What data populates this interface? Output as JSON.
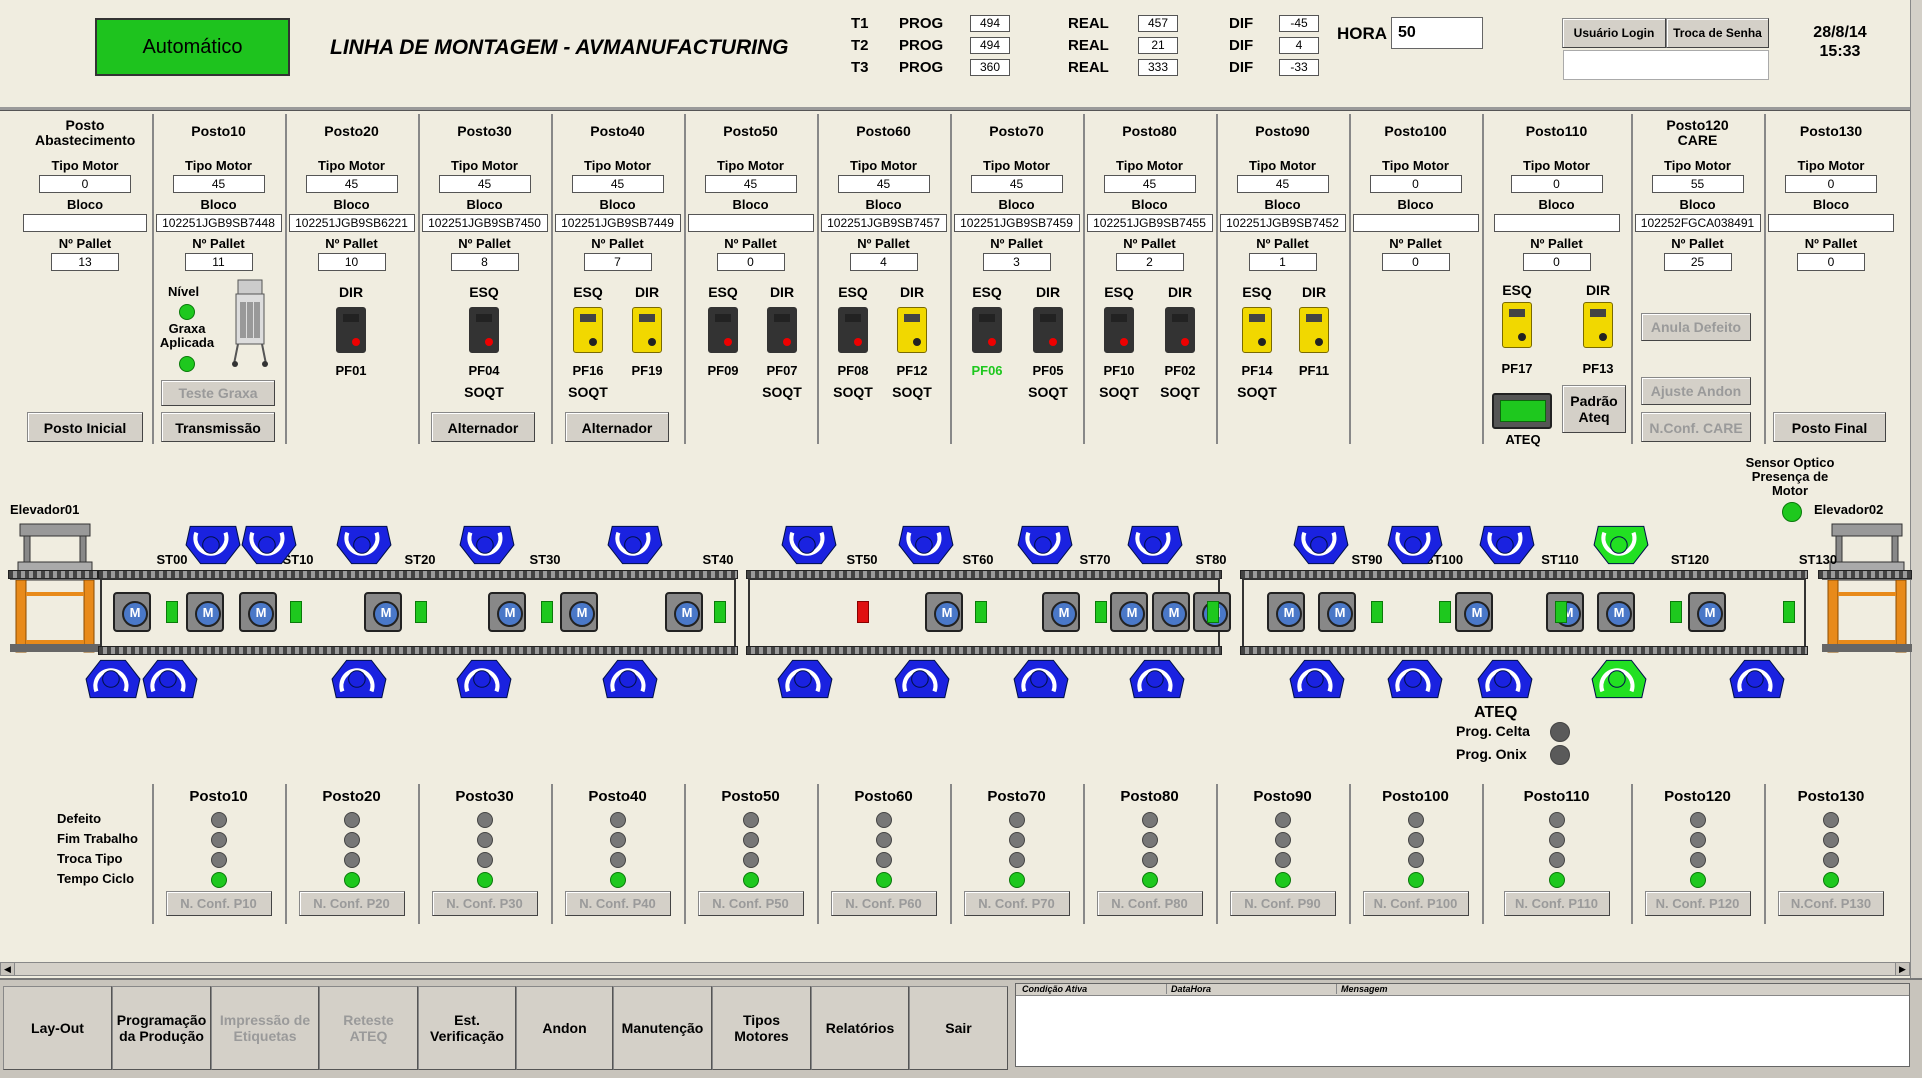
{
  "header": {
    "mode": "Automático",
    "title": "LINHA DE MONTAGEM - AVMANUFACTURING",
    "shifts": [
      {
        "t": "T1",
        "prog_label": "PROG",
        "prog": "494",
        "real_label": "REAL",
        "real": "457",
        "dif_label": "DIF",
        "dif": "-45"
      },
      {
        "t": "T2",
        "prog_label": "PROG",
        "prog": "494",
        "real_label": "REAL",
        "real": "21",
        "dif_label": "DIF",
        "dif": "4"
      },
      {
        "t": "T3",
        "prog_label": "PROG",
        "prog": "360",
        "real_label": "REAL",
        "real": "333",
        "dif_label": "DIF",
        "dif": "-33"
      }
    ],
    "hora_label": "HORA",
    "hora": "50",
    "login": "Usuário Login",
    "change_pw": "Troca de Senha",
    "date": "28/8/14",
    "time": "15:33"
  },
  "labels": {
    "tipo_motor": "Tipo Motor",
    "bloco": "Bloco",
    "pallet": "Nº Pallet",
    "esq": "ESQ",
    "dir": "DIR",
    "soqt": "SOQT",
    "nivel": "Nível",
    "graxa": "Graxa Aplicada",
    "ateq": "ATEQ",
    "padrao_ateq": "Padrão Ateq"
  },
  "stations": [
    {
      "name": "Posto Abastecimento",
      "tipo": "0",
      "bloco": "",
      "pallet": "13"
    },
    {
      "name": "Posto10",
      "tipo": "45",
      "bloco": "102251JGB9SB7448",
      "pallet": "11"
    },
    {
      "name": "Posto20",
      "tipo": "45",
      "bloco": "102251JGB9SB6221",
      "pallet": "10"
    },
    {
      "name": "Posto30",
      "tipo": "45",
      "bloco": "102251JGB9SB7450",
      "pallet": "8"
    },
    {
      "name": "Posto40",
      "tipo": "45",
      "bloco": "102251JGB9SB7449",
      "pallet": "7"
    },
    {
      "name": "Posto50",
      "tipo": "45",
      "bloco": "",
      "pallet": "0"
    },
    {
      "name": "Posto60",
      "tipo": "45",
      "bloco": "102251JGB9SB7457",
      "pallet": "4"
    },
    {
      "name": "Posto70",
      "tipo": "45",
      "bloco": "102251JGB9SB7459",
      "pallet": "3"
    },
    {
      "name": "Posto80",
      "tipo": "45",
      "bloco": "102251JGB9SB7455",
      "pallet": "2"
    },
    {
      "name": "Posto90",
      "tipo": "45",
      "bloco": "102251JGB9SB7452",
      "pallet": "1"
    },
    {
      "name": "Posto100",
      "tipo": "0",
      "bloco": "",
      "pallet": "0"
    },
    {
      "name": "Posto110",
      "tipo": "0",
      "bloco": "",
      "pallet": "0"
    },
    {
      "name": "Posto120 CARE",
      "tipo": "55",
      "bloco": "102252FGCA038491",
      "pallet": "25"
    },
    {
      "name": "Posto130",
      "tipo": "0",
      "bloco": "",
      "pallet": "0"
    }
  ],
  "tools": {
    "pf01": "PF01",
    "pf04": "PF04",
    "pf16": "PF16",
    "pf19": "PF19",
    "pf09": "PF09",
    "pf07": "PF07",
    "pf08": "PF08",
    "pf12": "PF12",
    "pf06": "PF06",
    "pf05": "PF05",
    "pf10": "PF10",
    "pf02": "PF02",
    "pf14": "PF14",
    "pf11": "PF11",
    "pf17": "PF17",
    "pf13": "PF13"
  },
  "buttons": {
    "posto_inicial": "Posto Inicial",
    "teste_graxa": "Teste Graxa",
    "transmissao": "Transmissão",
    "alternador1": "Alternador",
    "alternador2": "Alternador",
    "anula_defeito": "Anula Defeito",
    "ajuste_andon": "Ajuste Andon",
    "nconf_care": "N.Conf. CARE",
    "posto_final": "Posto Final"
  },
  "line": {
    "elev1": "Elevador01",
    "elev2": "Elevador02",
    "sensor": "Sensor Optico Presença de Motor",
    "st": [
      "ST00",
      "ST10",
      "ST20",
      "ST30",
      "ST40",
      "ST50",
      "ST60",
      "ST70",
      "ST80",
      "ST90",
      "ST100",
      "ST110",
      "ST120",
      "ST130"
    ],
    "ateq": "ATEQ",
    "prog_celta": "Prog. Celta",
    "prog_onix": "Prog. Onix"
  },
  "andon": {
    "rows": [
      "Defeito",
      "Fim Trabalho",
      "Troca Tipo",
      "Tempo Ciclo"
    ],
    "postos": [
      "Posto10",
      "Posto20",
      "Posto30",
      "Posto40",
      "Posto50",
      "Posto60",
      "Posto70",
      "Posto80",
      "Posto90",
      "Posto100",
      "Posto110",
      "Posto120",
      "Posto130"
    ],
    "nconf": [
      "N. Conf. P10",
      "N. Conf. P20",
      "N. Conf. P30",
      "N. Conf. P40",
      "N. Conf. P50",
      "N. Conf. P60",
      "N. Conf. P70",
      "N. Conf. P80",
      "N. Conf. P90",
      "N. Conf. P100",
      "N. Conf. P110",
      "N. Conf. P120",
      "N.Conf. P130"
    ]
  },
  "nav": [
    "Lay-Out",
    "Programação da Produção",
    "Impressão de Etiquetas",
    "Reteste ATEQ",
    "Est. Verificação",
    "Andon",
    "Manutenção",
    "Tipos Motores",
    "Relatórios",
    "Sair"
  ],
  "alarm": {
    "col1": "Condição Ativa",
    "col2": "DataHora",
    "col3": "Mensagem"
  }
}
